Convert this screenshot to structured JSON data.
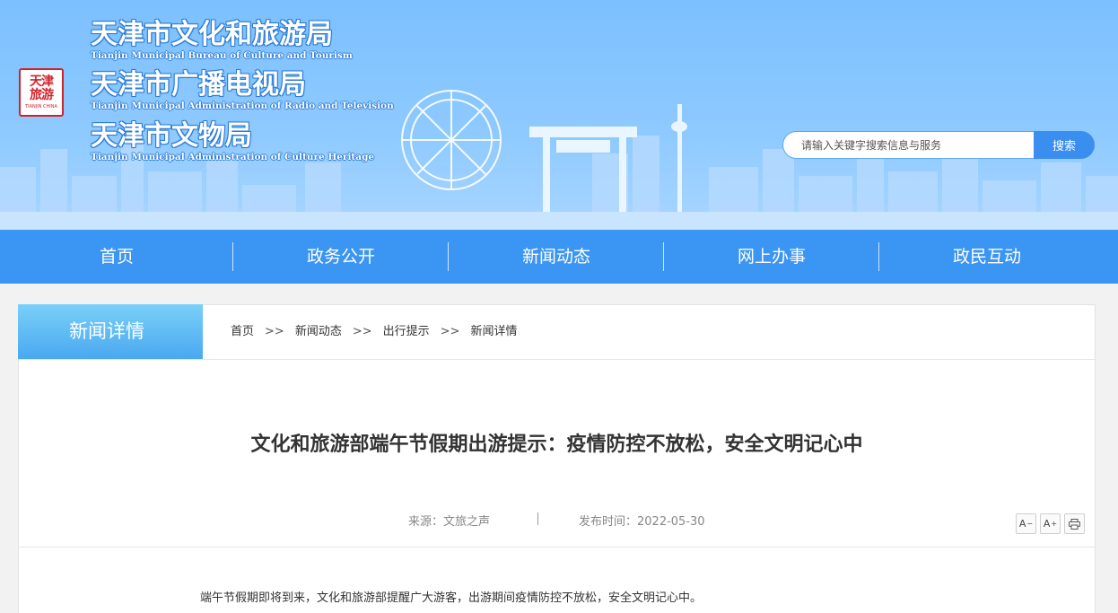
{
  "header": {
    "seal": {
      "line1": "天津",
      "line2": "旅游",
      "caption": "TIANJIN CHINA"
    },
    "orgs": [
      {
        "cn": "天津市文化和旅游局",
        "en": "Tianjin Municipal Bureau of Culture and Tourism"
      },
      {
        "cn": "天津市广播电视局",
        "en": "Tianjin Municipal Administration of Radio and Television"
      },
      {
        "cn": "天津市文物局",
        "en": "Tianjin Municipal Administration of Culture Heritage"
      }
    ],
    "search": {
      "placeholder": "请输入关键字搜索信息与服务",
      "button": "搜索"
    },
    "colors": {
      "sky": "#8fcaff",
      "skyline": "#b8dcff",
      "accent": "#3a8ef0"
    }
  },
  "nav": {
    "items": [
      "首页",
      "政务公开",
      "新闻动态",
      "网上办事",
      "政民互动"
    ]
  },
  "section": {
    "tab": "新闻详情",
    "breadcrumb": [
      "首页",
      "新闻动态",
      "出行提示",
      "新闻详情"
    ],
    "sep": ">>"
  },
  "article": {
    "title": "文化和旅游部端午节假期出游提示：疫情防控不放松，安全文明记心中",
    "source": "来源：文旅之声",
    "date": "发布时间：2022-05-30",
    "tools": {
      "decrease": "A",
      "increase": "A",
      "print": "print-icon"
    },
    "paragraph": "端午节假期即将到来，文化和旅游部提醒广大游客，出游期间疫情防控不放松，安全文明记心中。"
  }
}
